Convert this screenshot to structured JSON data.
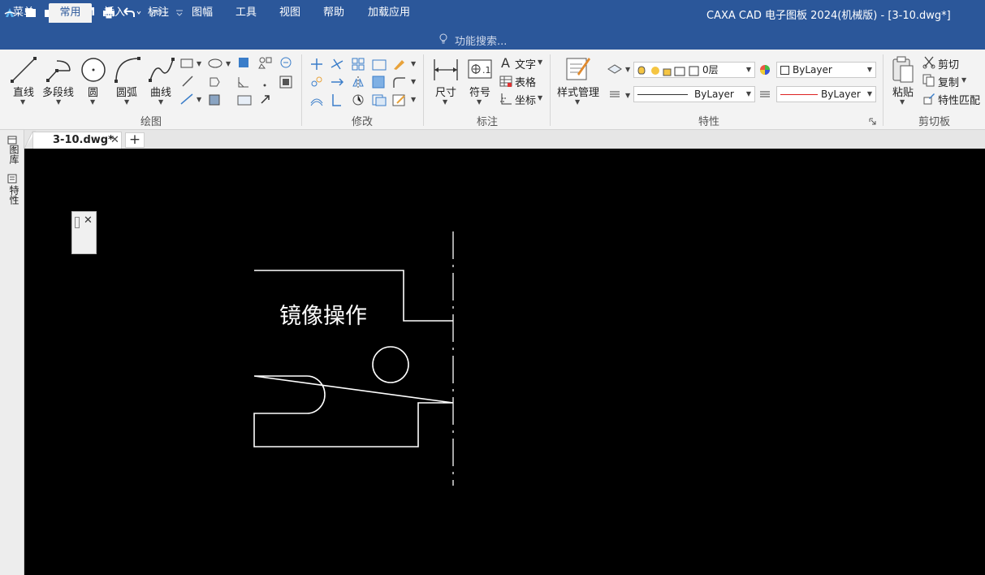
{
  "app": {
    "title": "CAXA CAD 电子图板 2024(机械版) - [3-10.dwg*]"
  },
  "quick_access": {
    "icons": [
      "app-logo-icon",
      "new-file-icon",
      "open-file-icon",
      "save-icon",
      "save-all-icon",
      "print-icon",
      "undo-icon",
      "redo-icon",
      "customize-icon"
    ]
  },
  "menu_tabs": [
    {
      "label": "菜单"
    },
    {
      "label": "常用",
      "active": true
    },
    {
      "label": "插入"
    },
    {
      "label": "标注"
    },
    {
      "label": "图幅"
    },
    {
      "label": "工具"
    },
    {
      "label": "视图"
    },
    {
      "label": "帮助"
    },
    {
      "label": "加载应用"
    }
  ],
  "search": {
    "placeholder": "功能搜索..."
  },
  "ribbon": {
    "draw": {
      "label": "绘图",
      "line": "直线",
      "polyline": "多段线",
      "circle": "圆",
      "arc": "圆弧",
      "spline": "曲线"
    },
    "modify": {
      "label": "修改"
    },
    "annotate": {
      "label": "标注",
      "dimension": "尺寸",
      "symbol": "符号",
      "text": "文字",
      "table": "表格",
      "coordinate": "坐标"
    },
    "style": {
      "label": "样式管理"
    },
    "properties": {
      "label": "特性",
      "layer": "0层",
      "color": "ByLayer",
      "linetype": "ByLayer",
      "lineweight": "ByLayer"
    },
    "clipboard": {
      "label": "剪切板",
      "paste": "粘贴",
      "cut": "剪切",
      "copy": "复制",
      "match": "特性匹配"
    }
  },
  "doc_tab": {
    "label": "3-10.dwg*"
  },
  "side_panel": {
    "library": "图库",
    "properties": "特性"
  },
  "drawing": {
    "annotation_text": "镜像操作"
  },
  "colors": {
    "accent": "#2b579a",
    "canvas": "#000000",
    "drawing_line": "#ffffff"
  }
}
